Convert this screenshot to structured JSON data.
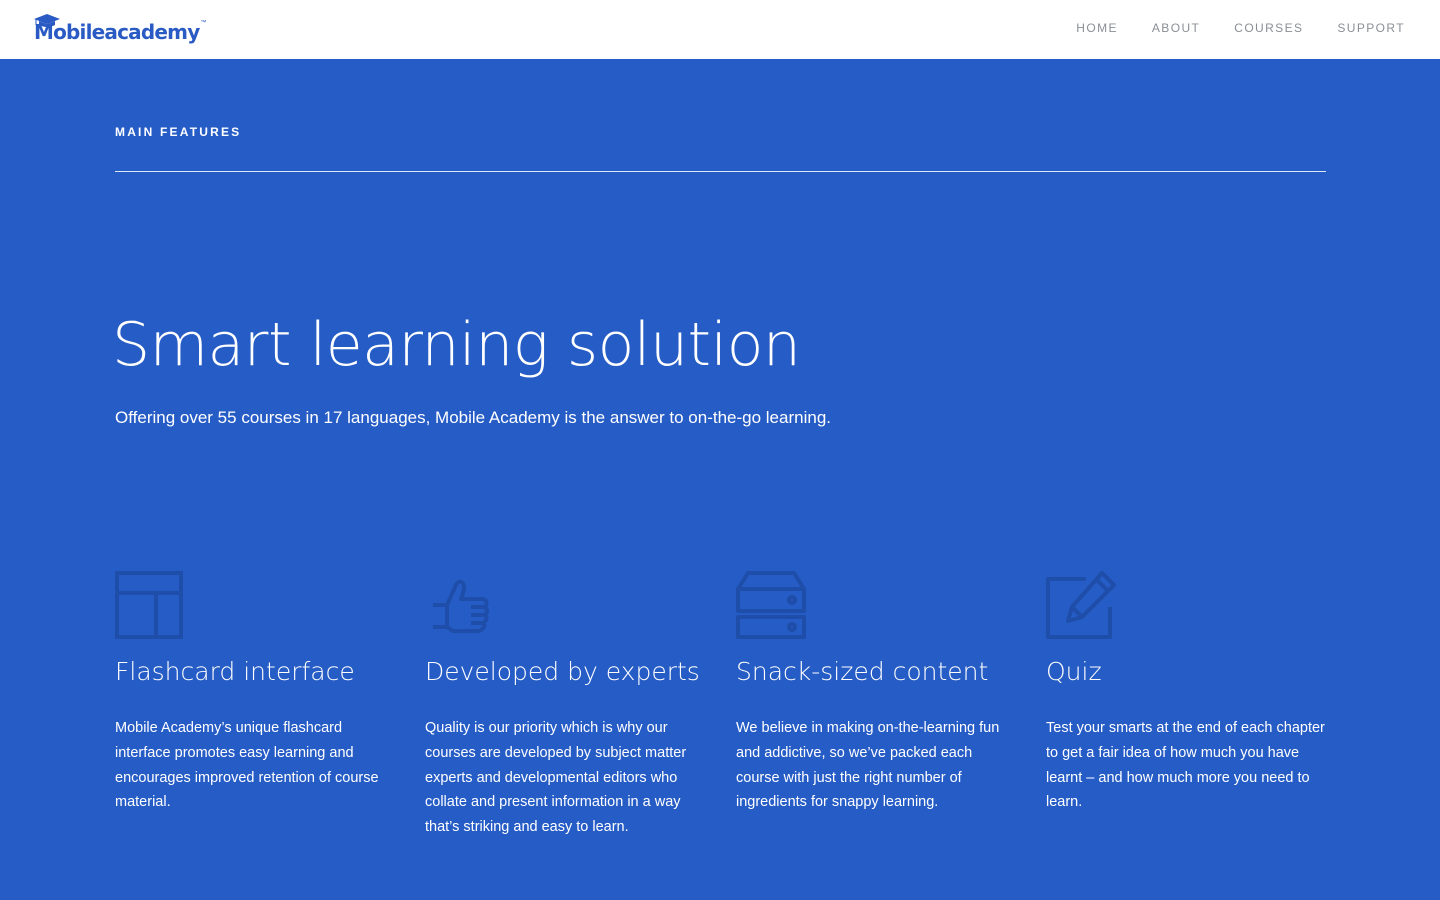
{
  "header": {
    "logo_text": "Mobileacademy",
    "logo_tm": "™",
    "nav": [
      {
        "label": "HOME"
      },
      {
        "label": "ABOUT"
      },
      {
        "label": "COURSES"
      },
      {
        "label": "SUPPORT"
      }
    ]
  },
  "main": {
    "section_label": "MAIN FEATURES",
    "hero_title": "Smart learning solution",
    "hero_subtitle": "Offering over 55 courses in 17 languages, Mobile Academy is the answer to on-the-go learning.",
    "features": [
      {
        "icon": "layout-icon",
        "title": "Flashcard interface",
        "description": "Mobile Academy’s unique flashcard interface promotes easy learning and encourages improved retention of course material."
      },
      {
        "icon": "thumbs-up-icon",
        "title": "Developed by experts",
        "description": "Quality is our priority which is why our courses are developed by subject matter experts and developmental editors who collate and present information in a way that’s striking and easy to learn."
      },
      {
        "icon": "server-icon",
        "title": "Snack-sized content",
        "description": "We believe in making on-the-learning fun and addictive, so we’ve packed each course with just the right number of ingredients for snappy learning."
      },
      {
        "icon": "edit-icon",
        "title": "Quiz",
        "description": "Test your smarts at the end of each chapter to get a fair idea of how much you have learnt – and how much more you need to learn."
      }
    ]
  },
  "colors": {
    "brand": "#2a5bc4",
    "background": "#265cc5",
    "icon": "#1e4ea9",
    "nav": "#8a8f96"
  }
}
